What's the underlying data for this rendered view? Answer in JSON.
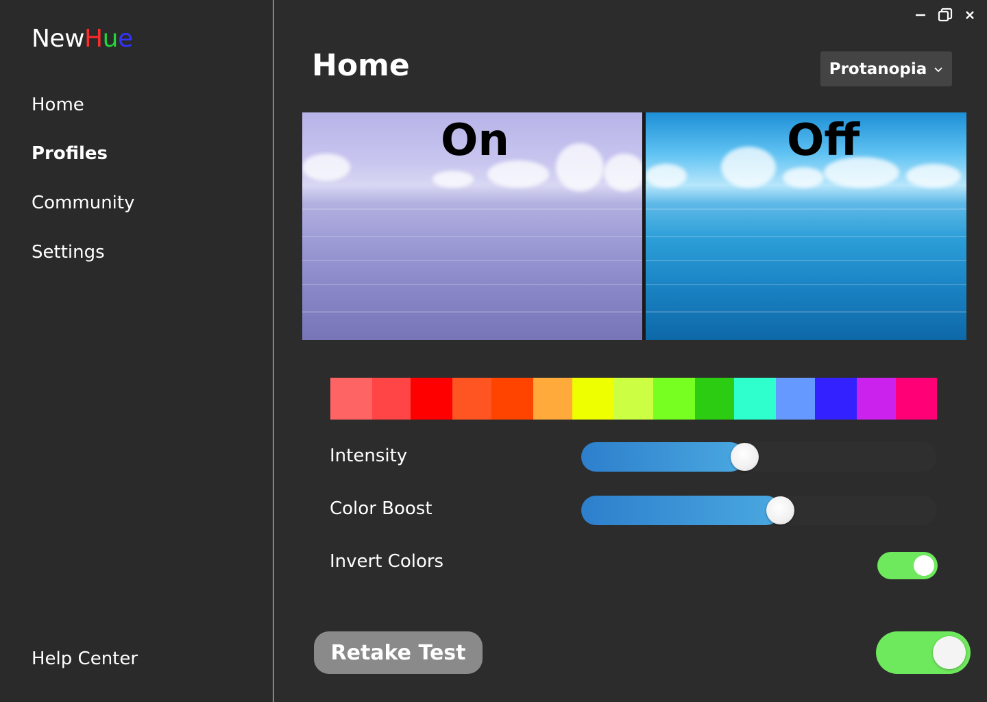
{
  "app": {
    "logo": {
      "part1": "New",
      "h": "H",
      "u": "u",
      "e": "e"
    },
    "colors": {
      "logo_h": "#ff2a2a",
      "logo_u": "#22d63a",
      "logo_e": "#3333ff",
      "accent_green": "#6ee85c",
      "slider_blue": "#3d95d8"
    }
  },
  "sidebar": {
    "items": [
      {
        "label": "Home",
        "active": false
      },
      {
        "label": "Profiles",
        "active": true
      },
      {
        "label": "Community",
        "active": false
      },
      {
        "label": "Settings",
        "active": false
      }
    ],
    "help": "Help Center"
  },
  "window_controls": {
    "icons": [
      "minimize-icon",
      "restore-icon",
      "close-icon"
    ]
  },
  "header": {
    "title": "Home",
    "profile_select": {
      "value": "Protanopia",
      "icon": "chevron-down-icon"
    }
  },
  "preview": {
    "on_label": "On",
    "off_label": "Off"
  },
  "color_strip": {
    "swatches": [
      "#ff6464",
      "#ff4545",
      "#ff0000",
      "#ff5522",
      "#ff4400",
      "#ffaa3a",
      "#eeff00",
      "#ccff44",
      "#77ff22",
      "#2ccc12",
      "#2effcc",
      "#6699ff",
      "#3322ff",
      "#cc22ee",
      "#ff0077"
    ]
  },
  "controls": {
    "intensity": {
      "label": "Intensity",
      "value": 0.42
    },
    "color_boost": {
      "label": "Color Boost",
      "value": 0.52
    },
    "invert_colors": {
      "label": "Invert Colors",
      "on": true
    }
  },
  "footer": {
    "retake_button": "Retake Test",
    "master_toggle_on": true
  }
}
